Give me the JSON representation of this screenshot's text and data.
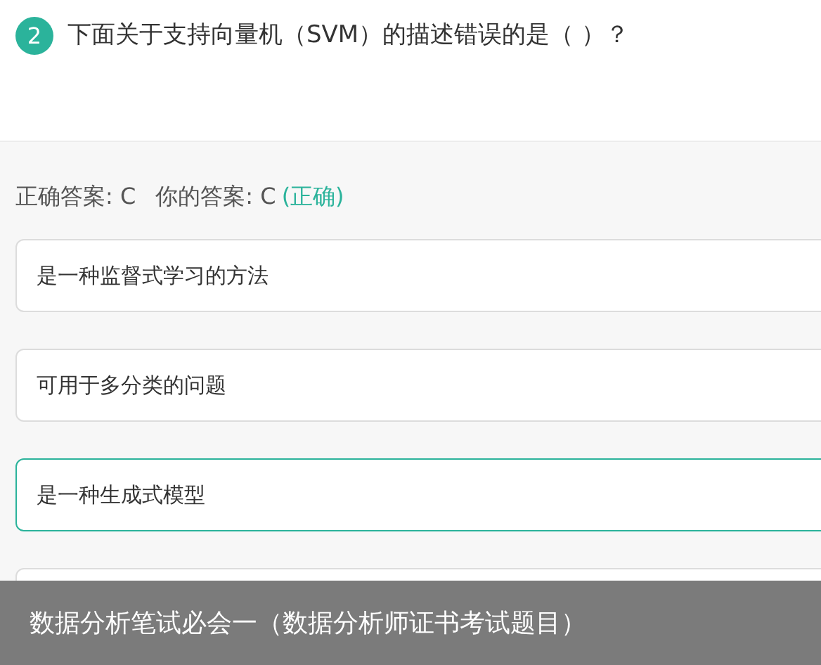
{
  "question": {
    "number": "2",
    "text": "下面关于支持向量机（SVM）的描述错误的是（ ）？"
  },
  "result": {
    "correct_label": "正确答案: C",
    "your_label": "你的答案: C",
    "verdict": "(正确)"
  },
  "options": [
    {
      "text": "是一种监督式学习的方法",
      "selected": false
    },
    {
      "text": "可用于多分类的问题",
      "selected": false
    },
    {
      "text": "是一种生成式模型",
      "selected": true
    },
    {
      "selected": false
    }
  ],
  "caption": "数据分析笔试必会一（数据分析师证书考试题目）"
}
